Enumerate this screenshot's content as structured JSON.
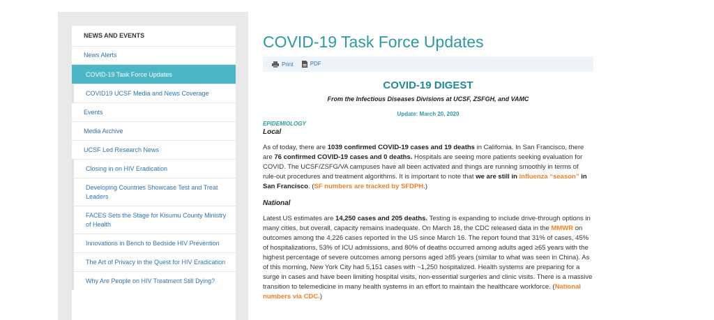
{
  "sidebar": {
    "heading": "NEWS AND EVENTS",
    "items": [
      {
        "label": "News Alerts"
      },
      {
        "label": "COVID-19 Task Force Updates",
        "active": true
      },
      {
        "label": "COVID19 UCSF Media and News Coverage"
      },
      {
        "label": "Events"
      },
      {
        "label": "Media Archive"
      },
      {
        "label": "UCSF Led Research News"
      }
    ],
    "subitems": [
      {
        "label": "Closing in on HIV Eradication"
      },
      {
        "label": "Developing Countries Showcase Test and Treat Leaders"
      },
      {
        "label": "FACES Sets the Stage for Kisumu County Ministry of Health"
      },
      {
        "label": "Innovations in Bench to Bedside HIV Prevention"
      },
      {
        "label": "The Art of Privacy in the Quest for HIV Eradication"
      },
      {
        "label": "Why Are People on HIV Treatment Still Dying?"
      }
    ]
  },
  "main": {
    "title": "COVID-19 Task Force Updates",
    "toolbar": {
      "print": "Print",
      "pdf": "PDF"
    },
    "digest_title": "COVID-19 DIGEST",
    "digest_subtitle": "From the Infectious Diseases Divisions at UCSF, ZSFGH, and VAMC",
    "update": "Update: March 20, 2020",
    "category": "EPIDEMIOLOGY",
    "local": {
      "heading": "Local",
      "t1": "As of today, there are ",
      "b1": "1039 confirmed COVID-19 cases and 19 deaths",
      "t2": " in California. In San Francisco, there are ",
      "b2": "76 confirmed COVID-19 cases and 0 deaths.",
      "t3": " Hospitals are seeing more patients seeking evaluation for COVID. The UCSF/ZSFG/VA campuses have all been activated and things are running smoothly in terms of rule-out procedures and treatment algorithms. It is important to note that ",
      "b3": "we are still in ",
      "o1": "influenza “season”",
      "b4": " in San Francisco",
      "t4": ". (",
      "link": "SF numbers are tracked by SFDPH",
      "t5": ".)"
    },
    "national": {
      "heading": "National",
      "t1": "Latest US estimates are ",
      "b1": "14,250 cases and 205 deaths.",
      "t2": " Testing is expanding to include drive-through options in many cities, but overall, capacity remains inadequate. On March 18, the CDC released data in the ",
      "link1": "MMWR",
      "t3": " on outcomes among the 4,226 cases reported in the US since March 16. The report found that 31% of cases, 45% of hospitalizations, 53% of ICU admissions, and 80% of deaths occurred among adults aged ≥65 years with the highest percentage of severe outcomes among persons aged ≥85 years (similar to what was seen in China). As of this morning, New York City had 5,151 cases with ~1,250 hospitalized. Health systems are preparing for a surge in cases and have been limiting hospital visits, non-essential surgeries and clinic visits. There is a massive transition to telemedicine in many health systems in an effort to maintain the healthcare workforce. (",
      "link2": "National numbers via CDC.",
      "t4": ")"
    }
  },
  "colors": {
    "accent": "#4ab7c6",
    "title": "#2a9aa4",
    "link": "#2d75b0",
    "highlight": "#f57f20"
  }
}
